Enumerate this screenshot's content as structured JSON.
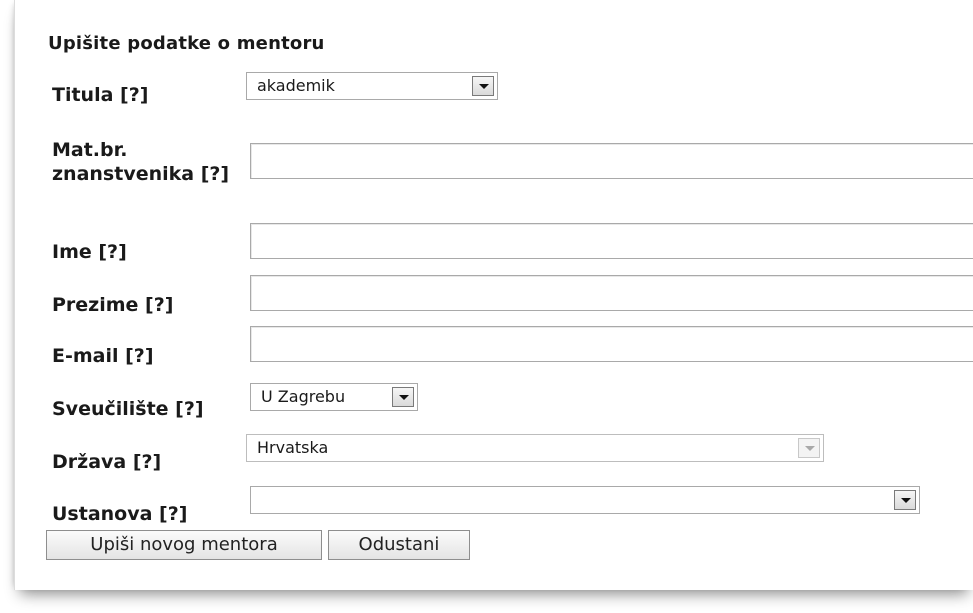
{
  "form": {
    "title": "Upišite podatke o mentoru",
    "fields": {
      "titula": {
        "label": "Titula [?]",
        "value": "akademik"
      },
      "mat_br": {
        "label": "Mat.br. znanstvenika [?]",
        "value": ""
      },
      "ime": {
        "label": "Ime [?]",
        "value": ""
      },
      "prezime": {
        "label": "Prezime [?]",
        "value": ""
      },
      "email": {
        "label": "E-mail [?]",
        "value": ""
      },
      "sveuciliste": {
        "label": "Sveučilište [?]",
        "value": "U Zagrebu"
      },
      "drzava": {
        "label": "Država [?]",
        "value": "Hrvatska"
      },
      "ustanova": {
        "label": "Ustanova [?]",
        "value": ""
      }
    },
    "buttons": {
      "submit": "Upiši novog mentora",
      "cancel": "Odustani"
    }
  }
}
